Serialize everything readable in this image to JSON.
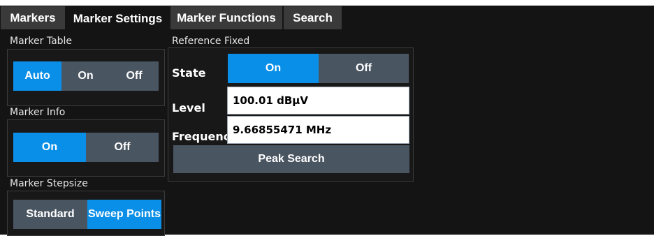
{
  "tabs": [
    {
      "label": "Markers",
      "active": false
    },
    {
      "label": "Marker Settings",
      "active": true
    },
    {
      "label": "Marker Functions",
      "active": false
    },
    {
      "label": "Search",
      "active": false
    }
  ],
  "marker_table": {
    "title": "Marker Table",
    "options": [
      "Auto",
      "On",
      "Off"
    ],
    "selected": "Auto"
  },
  "marker_info": {
    "title": "Marker Info",
    "options": [
      "On",
      "Off"
    ],
    "selected": "On"
  },
  "marker_stepsize": {
    "title": "Marker Stepsize",
    "options": [
      "Standard",
      "Sweep Points"
    ],
    "selected": "Sweep Points"
  },
  "reference_fixed": {
    "title": "Reference Fixed",
    "state_label": "State",
    "state_options": [
      "On",
      "Off"
    ],
    "state_selected": "On",
    "level_label": "Level",
    "level_value": "100.01 dBµV",
    "frequency_label": "Frequency",
    "frequency_value": "9.66855471 MHz",
    "peak_search_label": "Peak Search"
  },
  "colors": {
    "background": "#141414",
    "tab_inactive": "#3a3a3a",
    "control": "#4a5562",
    "selected": "#0a8fe8"
  }
}
